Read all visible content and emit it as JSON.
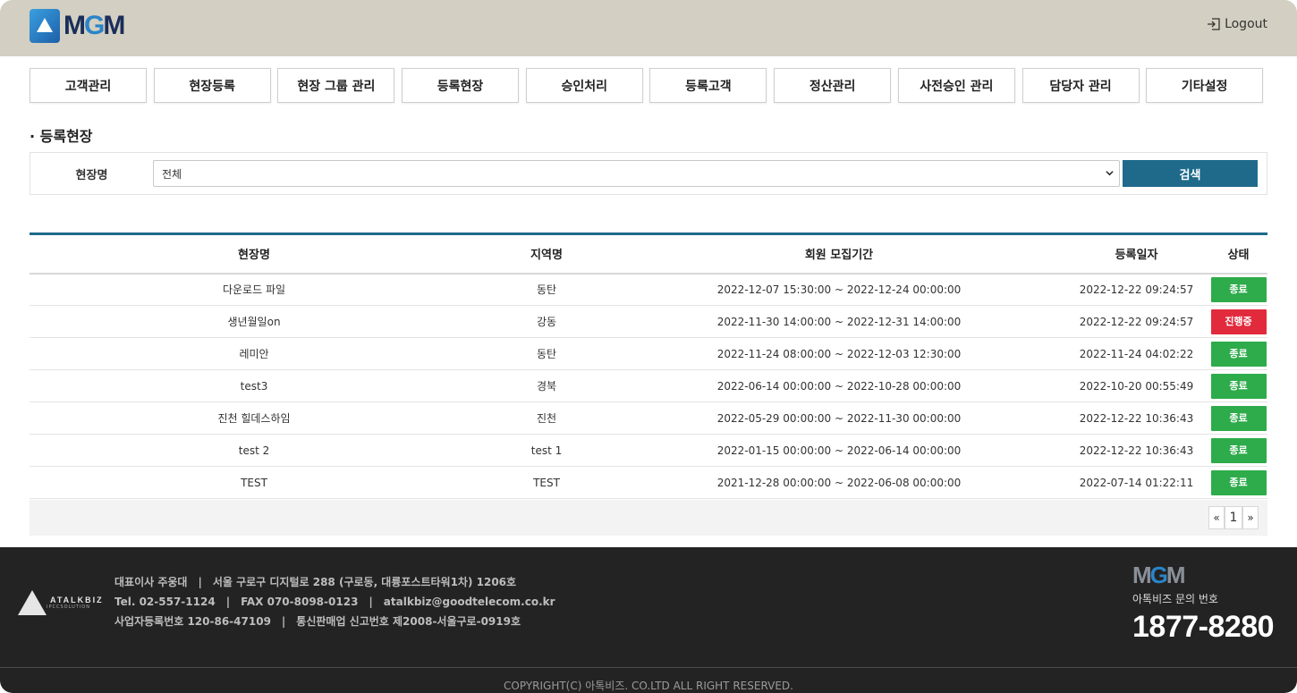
{
  "header": {
    "logo_text_m": "M",
    "logo_text_g": "G",
    "logo_text_m2": "M",
    "logout_label": "Logout"
  },
  "nav": {
    "items": [
      "고객관리",
      "현장등록",
      "현장 그룹 관리",
      "등록현장",
      "승인처리",
      "등록고객",
      "정산관리",
      "사전승인 관리",
      "담당자 관리",
      "기타설정"
    ]
  },
  "page": {
    "title": "· 등록현장"
  },
  "filter": {
    "label": "현장명",
    "selected": "전체",
    "search_label": "검색"
  },
  "table": {
    "columns": [
      "현장명",
      "지역명",
      "회원 모집기간",
      "등록일자",
      "상태"
    ],
    "rows": [
      {
        "name": "다운로드 파일",
        "region": "동탄",
        "period": "2022-12-07 15:30:00 ~ 2022-12-24 00:00:00",
        "date": "2022-12-22 09:24:57",
        "status": "종료",
        "status_color": "#2eab4b"
      },
      {
        "name": "생년월일on",
        "region": "강동",
        "period": "2022-11-30 14:00:00 ~ 2022-12-31 14:00:00",
        "date": "2022-12-22 09:24:57",
        "status": "진행중",
        "status_color": "#e22a3d"
      },
      {
        "name": "레미안",
        "region": "동탄",
        "period": "2022-11-24 08:00:00 ~ 2022-12-03 12:30:00",
        "date": "2022-11-24 04:02:22",
        "status": "종료",
        "status_color": "#2eab4b"
      },
      {
        "name": "test3",
        "region": "경북",
        "period": "2022-06-14 00:00:00 ~ 2022-10-28 00:00:00",
        "date": "2022-10-20 00:55:49",
        "status": "종료",
        "status_color": "#2eab4b"
      },
      {
        "name": "진천 힐데스하임",
        "region": "진천",
        "period": "2022-05-29 00:00:00 ~ 2022-11-30 00:00:00",
        "date": "2022-12-22 10:36:43",
        "status": "종료",
        "status_color": "#2eab4b"
      },
      {
        "name": "test 2",
        "region": "test 1",
        "period": "2022-01-15 00:00:00 ~ 2022-06-14 00:00:00",
        "date": "2022-12-22 10:36:43",
        "status": "종료",
        "status_color": "#2eab4b"
      },
      {
        "name": "TEST",
        "region": "TEST",
        "period": "2021-12-28 00:00:00 ~ 2022-06-08 00:00:00",
        "date": "2022-07-14 01:22:11",
        "status": "종료",
        "status_color": "#2eab4b"
      }
    ]
  },
  "pager": {
    "prev": "«",
    "current": "1",
    "next": "»"
  },
  "footer": {
    "logo_text": "ATALKBIZ",
    "logo_sub": "IPCCSOLUTION",
    "info_line1": "대표이사 주웅대　|　서울 구로구 디지털로 288 (구로동, 대륭포스트타워1차) 1206호",
    "info_line2": "Tel. 02-557-1124　|　FAX 070-8098-0123　|　atalkbiz@goodtelecom.co.kr",
    "info_line3": "사업자등록번호 120-86-47109　|　통신판매업 신고번호 제2008-서울구로-0919호",
    "mgm_m": "M",
    "mgm_g": "G",
    "mgm_m2": "M",
    "phone_label": "아톡비즈 문의 번호",
    "phone": "1877-8280",
    "copyright": "COPYRIGHT(C) 아톡비즈. CO.LTD ALL RIGHT RESERVED."
  },
  "colors": {
    "header_bg": "#d3cfc2",
    "accent": "#1f6a8b",
    "status_done": "#2eab4b",
    "status_active": "#e22a3d",
    "footer_bg": "#232323"
  }
}
